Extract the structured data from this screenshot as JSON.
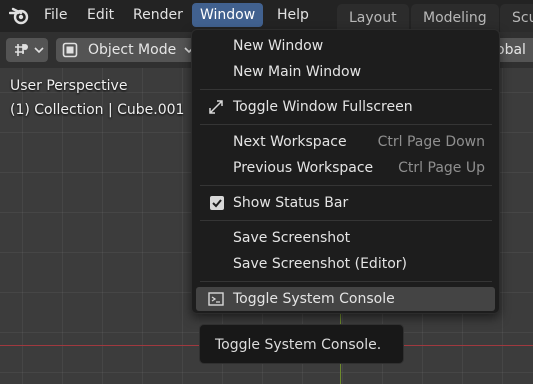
{
  "topbar": {
    "logo_icon": "blender-logo-icon",
    "menus": [
      "File",
      "Edit",
      "Render",
      "Window",
      "Help"
    ],
    "active_menu": "Window",
    "workspace_tabs": [
      "Layout",
      "Modeling",
      "Scu"
    ]
  },
  "viewport_header": {
    "editor_icon": "transform-gizmo-icon",
    "mode_icon": "object-mode-icon",
    "mode_label": "Object Mode",
    "orientation_partial": "obal"
  },
  "viewport": {
    "perspective_label": "User Perspective",
    "collection_label": "(1) Collection | Cube.001"
  },
  "window_menu": {
    "new_window": "New Window",
    "new_main_window": "New Main Window",
    "toggle_fullscreen": "Toggle Window Fullscreen",
    "fullscreen_icon": "fullscreen-arrows-icon",
    "next_workspace": "Next Workspace",
    "next_workspace_shortcut": "Ctrl Page Down",
    "previous_workspace": "Previous Workspace",
    "previous_workspace_shortcut": "Ctrl Page Up",
    "show_status_bar": "Show Status Bar",
    "show_status_bar_checked": true,
    "save_screenshot": "Save Screenshot",
    "save_screenshot_editor": "Save Screenshot (Editor)",
    "toggle_console": "Toggle System Console",
    "console_icon": "console-icon"
  },
  "tooltip": {
    "text": "Toggle System Console."
  },
  "colors": {
    "active_menu_bg": "#41618f",
    "menu_bg": "#1d1d1d",
    "highlight_row": "#444444",
    "x_axis": "#a0393f",
    "y_axis": "#6e8b2c"
  }
}
